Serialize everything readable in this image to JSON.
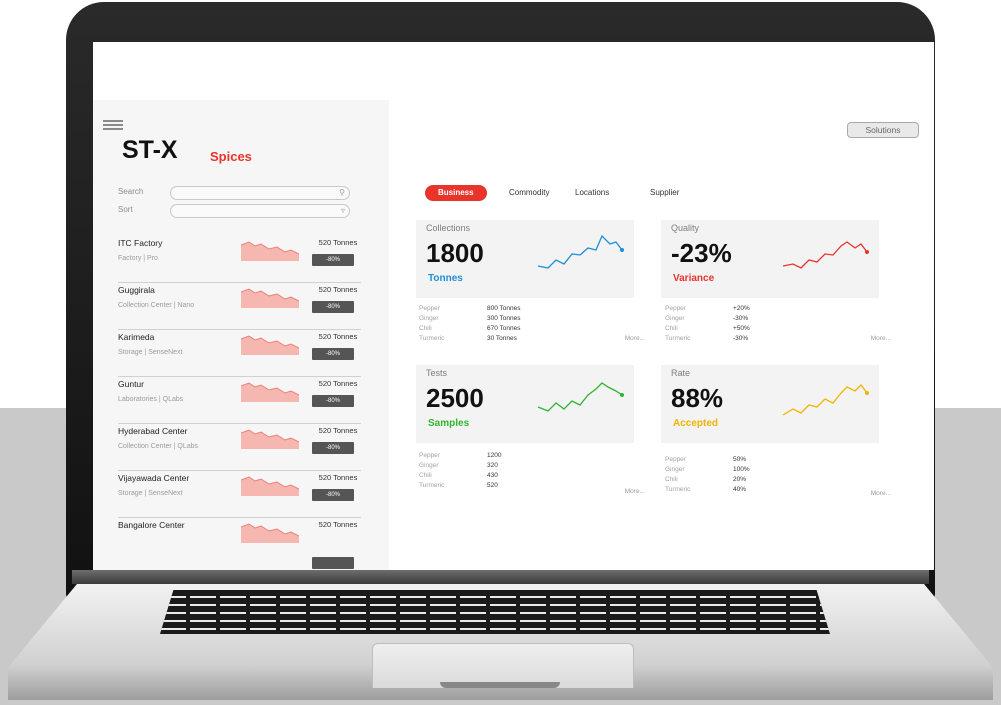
{
  "app": {
    "name": "ST-X",
    "subtitle": "Spices"
  },
  "top": {
    "solutions_label": "Solutions"
  },
  "filters": {
    "search_label": "Search",
    "sort_label": "Sort"
  },
  "locations": [
    {
      "name": "ITC Factory",
      "meta": "Factory | Pro",
      "tonnes": "520 Tonnes",
      "badge": "-80%"
    },
    {
      "name": "Guggirala",
      "meta": "Collection Center | Nano",
      "tonnes": "520 Tonnes",
      "badge": "-80%"
    },
    {
      "name": "Karimeda",
      "meta": "Storage | SenseNext",
      "tonnes": "520 Tonnes",
      "badge": "-80%"
    },
    {
      "name": "Guntur",
      "meta": "Laboratories | QLabs",
      "tonnes": "520 Tonnes",
      "badge": "-80%"
    },
    {
      "name": "Hyderabad Center",
      "meta": "Collection Center | QLabs",
      "tonnes": "520 Tonnes",
      "badge": "-80%"
    },
    {
      "name": "Vijayawada Center",
      "meta": "Storage | SenseNext",
      "tonnes": "520 Tonnes",
      "badge": "-80%"
    },
    {
      "name": "Bangalore Center",
      "meta": "",
      "tonnes": "520 Tonnes",
      "badge": ""
    }
  ],
  "tabs": [
    {
      "label": "Business",
      "active": true
    },
    {
      "label": "Commodity",
      "active": false
    },
    {
      "label": "Locations",
      "active": false
    },
    {
      "label": "Supplier",
      "active": false
    }
  ],
  "cards": {
    "collections": {
      "title": "Collections",
      "value": "1800",
      "unit": "Tonnes",
      "color": "#1e8fd6"
    },
    "quality": {
      "title": "Quality",
      "value": "-23%",
      "unit": "Variance",
      "color": "#e8342b"
    },
    "tests": {
      "title": "Tests",
      "value": "2500",
      "unit": "Samples",
      "color": "#2fb52f"
    },
    "rate": {
      "title": "Rate",
      "value": "88%",
      "unit": "Accepted",
      "color": "#f0b400"
    }
  },
  "breakdowns": {
    "collections": {
      "rows": [
        [
          "Pepper",
          "800 Tonnes"
        ],
        [
          "Ginger",
          "300 Tonnes"
        ],
        [
          "Chili",
          "670 Tonnes"
        ],
        [
          "Turmeric",
          "30 Tonnes"
        ]
      ],
      "more": "More..."
    },
    "quality": {
      "rows": [
        [
          "Pepper",
          "+20%"
        ],
        [
          "Ginger",
          "-30%"
        ],
        [
          "Chili",
          "+50%"
        ],
        [
          "Turmeric",
          "-30%"
        ]
      ],
      "more": "More..."
    },
    "tests": {
      "rows": [
        [
          "Pepper",
          "1200"
        ],
        [
          "Ginger",
          "320"
        ],
        [
          "Chili",
          "430"
        ],
        [
          "Turmeric",
          "520"
        ]
      ],
      "more": "More..."
    },
    "rate": {
      "rows": [
        [
          "Pepper",
          "50%"
        ],
        [
          "Ginger",
          "100%"
        ],
        [
          "Chili",
          "20%"
        ],
        [
          "Turmeric",
          "40%"
        ]
      ],
      "more": "More..."
    }
  },
  "colors": {
    "accent": "#e8342b",
    "badge": "#555555",
    "sparkline_area": "#f6b7b1"
  }
}
